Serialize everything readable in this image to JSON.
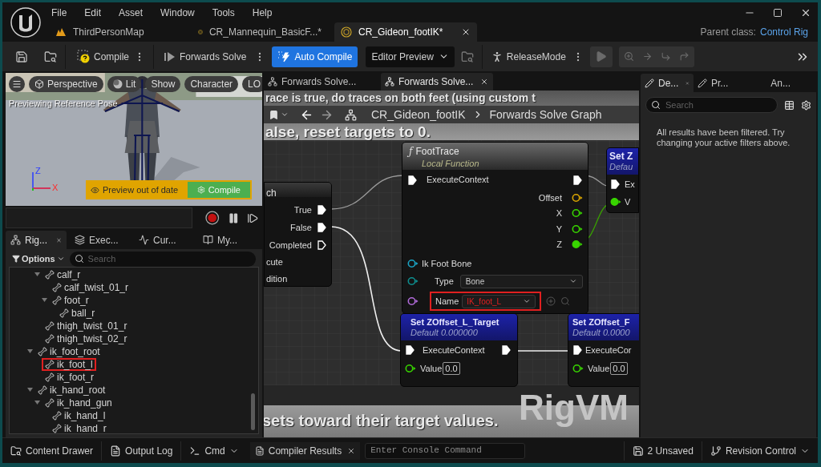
{
  "menu": [
    "File",
    "Edit",
    "Asset",
    "Window",
    "Tools",
    "Help"
  ],
  "doc_tabs": [
    {
      "label": "ThirdPersonMap",
      "kind": "map",
      "selected": false
    },
    {
      "label": "CR_Mannequin_BasicF...*",
      "kind": "rig",
      "selected": false
    },
    {
      "label": "CR_Gideon_footIK*",
      "kind": "rig",
      "selected": true
    }
  ],
  "parent_class": {
    "label": "Parent class:",
    "value": "Control Rig"
  },
  "toolbar": {
    "compile": "Compile",
    "forwards_solve": "Forwards Solve",
    "auto_compile": {
      "label": "Auto Compile",
      "on": true
    },
    "preview": "Editor Preview",
    "release_mode": "ReleaseMode",
    "debug_disabled": true
  },
  "viewport": {
    "buttons": [
      {
        "label": "Perspective",
        "kind": "cube"
      },
      {
        "label": "Lit",
        "kind": "sphere"
      },
      {
        "label": "Show",
        "kind": "plain"
      },
      {
        "label": "Character",
        "kind": "plain"
      },
      {
        "label": "LO",
        "kind": "plain"
      }
    ],
    "status": "Previewing Reference Pose",
    "axes": [
      "Z",
      "X"
    ],
    "banner": {
      "message": "Preview out of date",
      "button": "Compile"
    }
  },
  "left_tabs": [
    {
      "label": "Rig...",
      "kind": "hierarchy",
      "selected": true
    },
    {
      "label": "Exec...",
      "kind": "stack",
      "selected": false
    },
    {
      "label": "Cur...",
      "kind": "curve",
      "selected": false
    },
    {
      "label": "My...",
      "kind": "book",
      "selected": false
    }
  ],
  "options": "Options",
  "left_search": {
    "placeholder": "Search"
  },
  "tree_continued": [
    {
      "label": "calf_r",
      "expanded": true,
      "highlighted": false,
      "children": [
        {
          "label": "calf_twist_01_r",
          "highlighted": false
        },
        {
          "label": "foot_r",
          "expanded": true,
          "highlighted": false,
          "children": [
            {
              "label": "ball_r",
              "highlighted": false
            }
          ]
        }
      ]
    },
    {
      "label": "thigh_twist_01_r",
      "highlighted": false
    },
    {
      "label": "thigh_twist_02_r",
      "highlighted": false
    }
  ],
  "tree": [
    {
      "label": "ik_foot_root",
      "expanded": true,
      "highlighted": false,
      "children": [
        {
          "label": "ik_foot_l",
          "highlighted": true
        },
        {
          "label": "ik_foot_r",
          "highlighted": false
        }
      ]
    },
    {
      "label": "ik_hand_root",
      "expanded": true,
      "highlighted": false,
      "children": [
        {
          "label": "ik_hand_gun",
          "expanded": true,
          "highlighted": false,
          "children": [
            {
              "label": "ik_hand_l",
              "highlighted": false
            },
            {
              "label": "ik_hand_r",
              "highlighted": false
            }
          ]
        }
      ]
    }
  ],
  "graph_tabs": [
    {
      "label": "Forwards Solve...",
      "selected": false
    },
    {
      "label": "Forwards Solve...",
      "selected": true
    }
  ],
  "breadcrumb": [
    "CR_Gideon_footIK",
    "Forwards Solve Graph"
  ],
  "comments": [
    {
      "lines": [
        "race is true, do traces on both feet (using custom t",
        "alse, reset targets to 0."
      ]
    },
    {
      "lines": [
        "sets toward their target values."
      ]
    }
  ],
  "graph_label": "RigVM",
  "branch_node": {
    "title": "ch",
    "outputs": [
      {
        "label": "True",
        "connected": true
      },
      {
        "label": "False",
        "connected": true
      },
      {
        "label": "Completed",
        "connected": false
      }
    ],
    "inputs": [
      "cute",
      "dition"
    ]
  },
  "foot_trace": {
    "glyph": "ƒ",
    "title": "FootTrace",
    "subtitle": "Local Function",
    "exec": "ExecuteContext",
    "outputs": [
      {
        "label": "Offset",
        "kind": "struct",
        "connected": false
      },
      {
        "label": "X",
        "kind": "float",
        "connected": false
      },
      {
        "label": "Y",
        "kind": "float",
        "connected": false
      },
      {
        "label": "Z",
        "kind": "float",
        "connected": true
      }
    ],
    "input_group": "Ik Foot Bone",
    "type": {
      "label": "Type",
      "value": "Bone"
    },
    "name": {
      "label": "Name",
      "value": "IK_foot_L",
      "highlighted": true
    }
  },
  "set_nodes": [
    {
      "title": "Set ZOffset_L_Target",
      "subtitle": "Default 0.000000",
      "exec": "ExecuteContext",
      "value_label": "Value",
      "value": "0.0"
    },
    {
      "title": "Set ZOffset_F",
      "subtitle": "Default 0.0000",
      "exec": "ExecuteCor",
      "value_label": "Value",
      "value": "0.0"
    }
  ],
  "set_z_node": {
    "title": "Set Z",
    "subtitle": "Defau",
    "exec": "Ex",
    "value_label": "V"
  },
  "details_tabs": [
    {
      "label": "De...",
      "kind": "pencil",
      "selected": true
    },
    {
      "label": "Pr...",
      "kind": "pencil",
      "selected": false
    },
    {
      "label": "An...",
      "kind": "plain",
      "selected": false
    }
  ],
  "details_search": {
    "placeholder": "Search"
  },
  "details_message": "All results have been filtered. Try changing your active filters above.",
  "status_bar": {
    "content_drawer": "Content Drawer",
    "output_log": "Output Log",
    "cmd": "Cmd",
    "console": {
      "placeholder": "Enter Console Command"
    },
    "compiler_tab": "Compiler Results",
    "unsaved": "2 Unsaved",
    "revision": "Revision Control"
  }
}
